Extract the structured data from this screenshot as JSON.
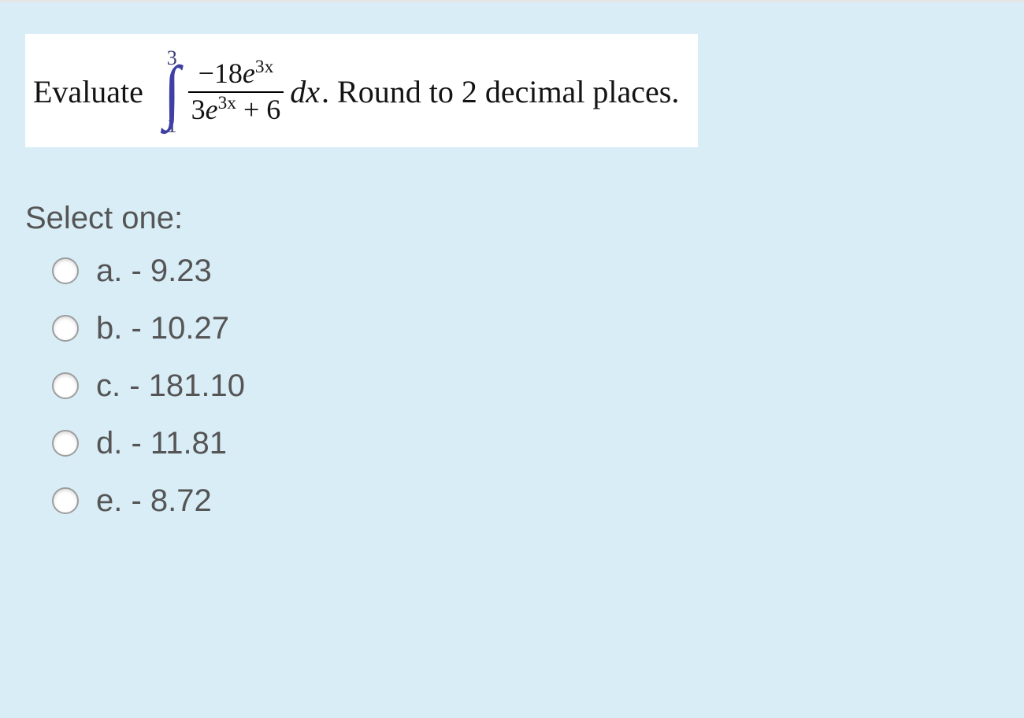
{
  "question": {
    "prefix": "Evaluate",
    "integral_upper": "3",
    "integral_lower": "1",
    "numerator_minus": "−",
    "numerator_coeff": "18",
    "numerator_e": "e",
    "numerator_exp": "3x",
    "denominator_a_coeff": "3",
    "denominator_a_e": "e",
    "denominator_a_exp": "3x",
    "denominator_plus": " + ",
    "denominator_b": "6",
    "dx": "dx",
    "suffix": ". Round to 2 decimal places."
  },
  "select_one": "Select one:",
  "options": [
    {
      "letter": "a.",
      "text": "- 9.23"
    },
    {
      "letter": "b.",
      "text": "- 10.27"
    },
    {
      "letter": "c.",
      "text": "- 181.10"
    },
    {
      "letter": "d.",
      "text": "- 11.81"
    },
    {
      "letter": "e.",
      "text": "- 8.72"
    }
  ]
}
